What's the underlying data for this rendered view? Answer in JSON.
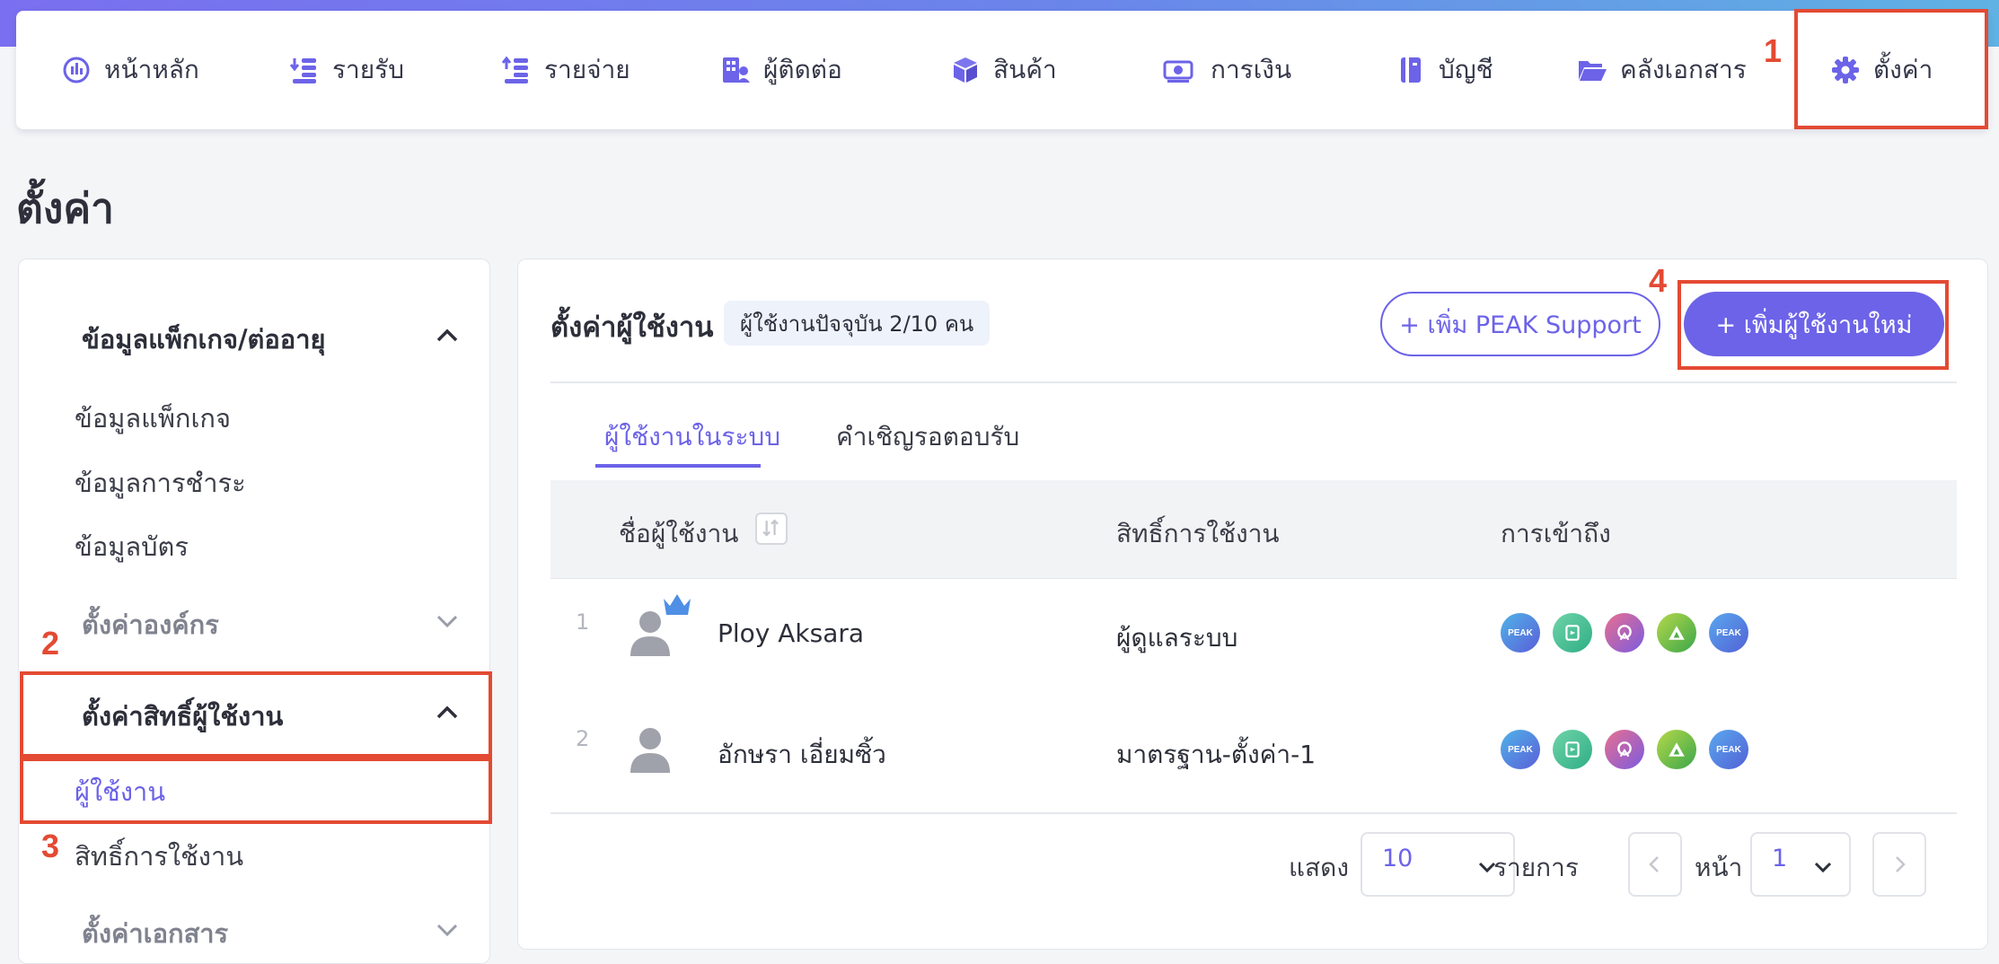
{
  "nav": {
    "items": [
      {
        "label": "หน้าหลัก",
        "icon": "dashboard-gauge-icon"
      },
      {
        "label": "รายรับ",
        "icon": "income-coins-icon"
      },
      {
        "label": "รายจ่าย",
        "icon": "expense-coins-icon"
      },
      {
        "label": "ผู้ติดต่อ",
        "icon": "contacts-building-icon"
      },
      {
        "label": "สินค้า",
        "icon": "product-box-icon"
      },
      {
        "label": "การเงิน",
        "icon": "money-bill-icon"
      },
      {
        "label": "บัญชี",
        "icon": "account-book-icon"
      },
      {
        "label": "คลังเอกสาร",
        "icon": "folder-open-icon"
      },
      {
        "label": "ตั้งค่า",
        "icon": "gear-icon"
      }
    ]
  },
  "annotations": {
    "n1": "1",
    "n2": "2",
    "n3": "3",
    "n4": "4"
  },
  "page": {
    "title": "ตั้งค่า"
  },
  "sidebar": {
    "group_package": "ข้อมูลแพ็กเกจ/ต่ออายุ",
    "item_package_info": "ข้อมูลแพ็กเกจ",
    "item_payment_info": "ข้อมูลการชำระ",
    "item_card_info": "ข้อมูลบัตร",
    "group_org": "ตั้งค่าองค์กร",
    "group_permissions": "ตั้งค่าสิทธิ์ผู้ใช้งาน",
    "item_users": "ผู้ใช้งาน",
    "item_roles": "สิทธิ์การใช้งาน",
    "group_documents": "ตั้งค่าเอกสาร"
  },
  "card": {
    "title": "ตั้งค่าผู้ใช้งาน",
    "count_badge": "ผู้ใช้งานปัจจุบัน 2/10 คน",
    "btn_add_support": "+ เพิ่ม PEAK Support",
    "btn_add_user": "+ เพิ่มผู้ใช้งานใหม่"
  },
  "tabs": {
    "active": "ผู้ใช้งานในระบบ",
    "pending": "คำเชิญรอตอบรับ"
  },
  "table": {
    "headers": {
      "name": "ชื่อผู้ใช้งาน",
      "role": "สิทธิ์การใช้งาน",
      "access": "การเข้าถึง"
    },
    "rows": [
      {
        "index": "1",
        "name": "Ploy Aksara",
        "role": "ผู้ดูแลระบบ",
        "owner": true
      },
      {
        "index": "2",
        "name": "อักษรา เอี่ยมซิ้ว",
        "role": "มาตรฐาน-ตั้งค่า-1",
        "owner": false
      }
    ],
    "app_icons": [
      {
        "name": "peak-app-icon",
        "text": "PEAK",
        "color": "#3f7fd9"
      },
      {
        "name": "peak-receipt-app-icon",
        "text": "",
        "color": "#3cbf8d"
      },
      {
        "name": "peak-sign-app-icon",
        "text": "",
        "color": "#a35bd1"
      },
      {
        "name": "peak-triangle-app-icon",
        "text": "",
        "color": "#5ab23c"
      },
      {
        "name": "peak-tax-app-icon",
        "text": "PEAK",
        "color": "#4a7fe0"
      }
    ]
  },
  "pagination": {
    "show_label": "แสดง",
    "page_size": "10",
    "items_label": "รายการ",
    "page_label": "หน้า",
    "page_number": "1"
  },
  "colors": {
    "accent": "#6c63e8",
    "annotation": "#e34a33"
  }
}
